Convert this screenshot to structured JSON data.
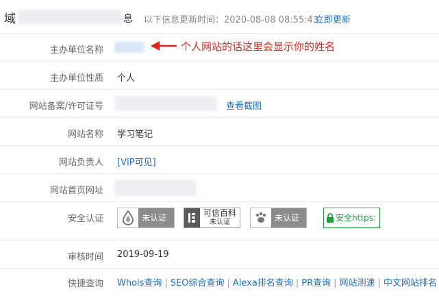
{
  "header": {
    "title_prefix": "域",
    "title_suffix": "息",
    "update_note": "以下信息更新时间：2020-08-08 08:55:43",
    "refresh_link": "立即更新"
  },
  "rows": [
    {
      "label": "主办单位名称",
      "value": ""
    },
    {
      "label": "主办单位性质",
      "value": "个人"
    },
    {
      "label": "网站备案/许可证号",
      "value": "",
      "link": "查看截图"
    },
    {
      "label": "网站名称",
      "value": "学习笔记"
    },
    {
      "label": "网站负责人",
      "value": "[VIP可见]"
    },
    {
      "label": "网站首页网址",
      "value": ""
    },
    {
      "label": "安全认证",
      "value": ""
    },
    {
      "label": "审核时间",
      "value": "2019-09-19"
    },
    {
      "label": "快捷查询",
      "value": ""
    }
  ],
  "annotation": "个人网站的话这里会显示你的姓名",
  "badges": [
    {
      "text": "未认证",
      "icon": "drop-icon",
      "bg": "#8c8c8c"
    },
    {
      "text1": "可信百科",
      "text2": "未认证",
      "icon": "kexin-icon",
      "bg": "#ffffff"
    },
    {
      "text": "未认证",
      "icon": "paw-icon",
      "bg": "#8c8c8c"
    },
    {
      "text": "安全https:",
      "icon": "lock-icon",
      "bg": "#ffffff"
    }
  ],
  "quick_links": [
    "Whois查询",
    "SEO综合查询",
    "Alexa排名查询",
    "PR查询",
    "网站测速",
    "中文网站排名"
  ],
  "colors": {
    "link": "#1e6fc6",
    "annotation": "#e0261b",
    "https_green": "#1aa33c"
  }
}
